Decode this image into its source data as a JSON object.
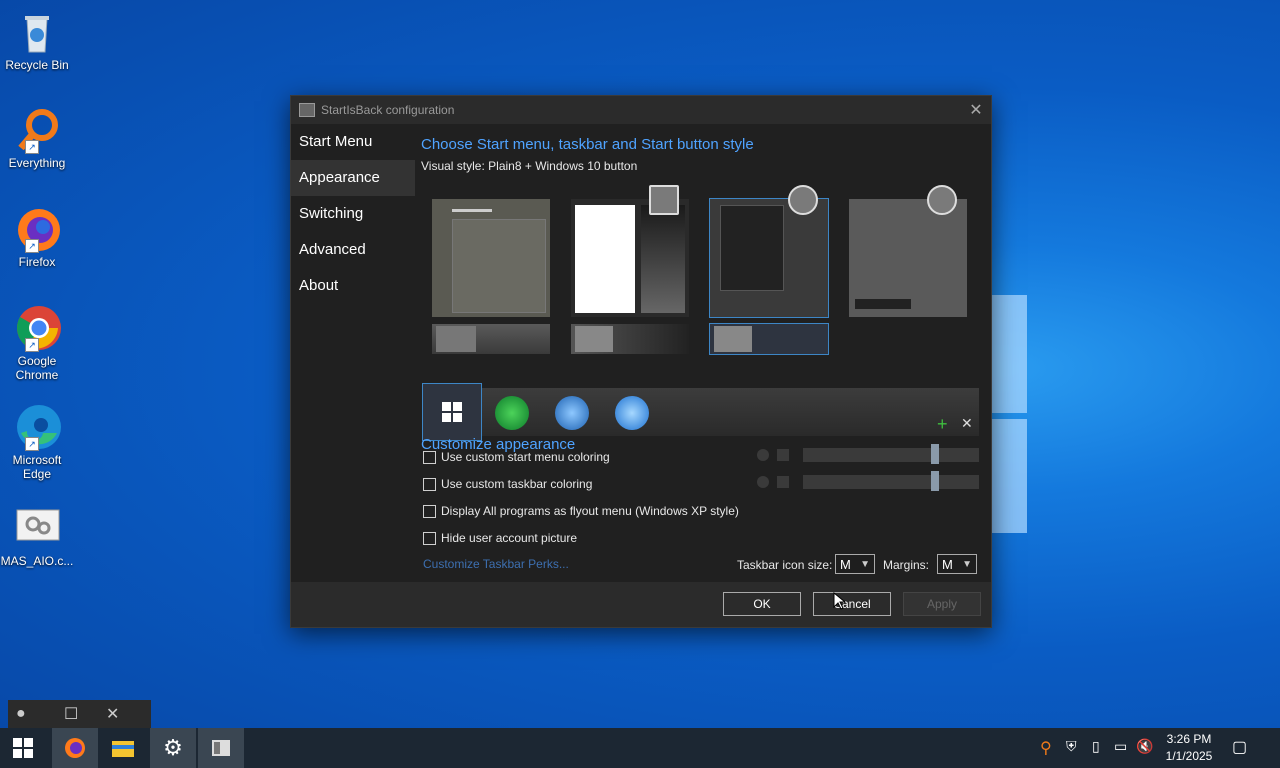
{
  "desktop": {
    "icons": [
      {
        "label": "Recycle Bin"
      },
      {
        "label": "Everything"
      },
      {
        "label": "Firefox"
      },
      {
        "label": "Google Chrome"
      },
      {
        "label": "Microsoft Edge"
      },
      {
        "label": "MAS_AIO.c..."
      }
    ]
  },
  "dialog": {
    "title": "StartIsBack configuration",
    "nav": [
      "Start Menu",
      "Appearance",
      "Switching",
      "Advanced",
      "About"
    ],
    "active_nav": "Appearance",
    "heading": "Choose Start menu, taskbar and Start button style",
    "visual_style_label": "Visual style:",
    "visual_style_value": "Plain8 + Windows 10 button",
    "customize_heading": "Customize appearance",
    "options": [
      {
        "label": "Use custom start menu coloring",
        "checked": false
      },
      {
        "label": "Use custom taskbar coloring",
        "checked": false
      },
      {
        "label": "Display All programs as flyout menu (Windows XP style)",
        "checked": false
      },
      {
        "label": "Hide user account picture",
        "checked": false
      }
    ],
    "perks_link": "Customize Taskbar Perks...",
    "taskbar_icon_size_label": "Taskbar icon size:",
    "taskbar_icon_size_value": "M",
    "margins_label": "Margins:",
    "margins_value": "M",
    "buttons": {
      "ok": "OK",
      "cancel": "Cancel",
      "apply": "Apply"
    }
  },
  "taskbar": {
    "time": "3:26 PM",
    "date": "1/1/2025"
  },
  "colors": {
    "accent": "#4fa3ff",
    "dialog_bg": "#202020",
    "taskbar_bg": "#1c2733"
  }
}
